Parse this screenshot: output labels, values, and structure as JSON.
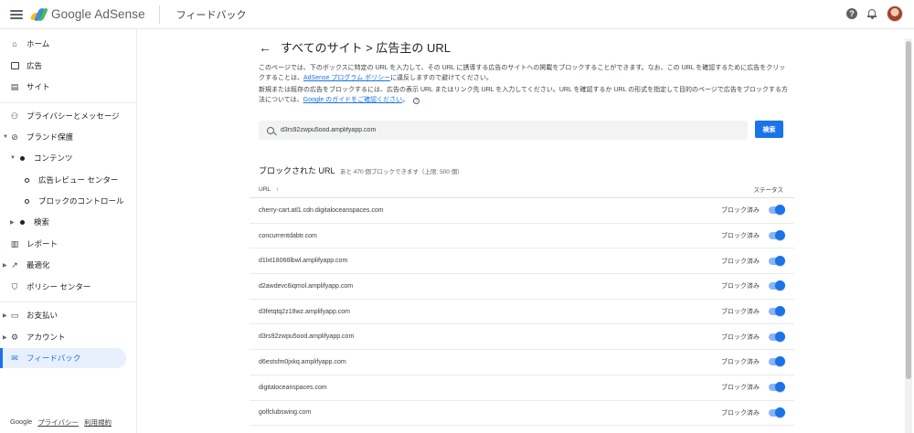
{
  "header": {
    "logo_text": "Google AdSense",
    "page_title": "フィードバック",
    "help_glyph": "?"
  },
  "sidebar": {
    "items": [
      {
        "label": "ホーム",
        "icon": "home-icon"
      },
      {
        "label": "広告",
        "icon": "ads-icon"
      },
      {
        "label": "サイト",
        "icon": "sites-icon"
      },
      {
        "label": "プライバシーとメッセージ",
        "icon": "privacy-icon"
      },
      {
        "label": "ブランド保護",
        "icon": "block-icon"
      },
      {
        "label": "コンテンツ",
        "icon": "dot-icon"
      },
      {
        "label": "広告レビュー センター",
        "icon": "ring-icon"
      },
      {
        "label": "ブロックのコントロール",
        "icon": "ring-icon"
      },
      {
        "label": "検索",
        "icon": "dot-icon"
      },
      {
        "label": "レポート",
        "icon": "reports-icon"
      },
      {
        "label": "最適化",
        "icon": "trending-icon"
      },
      {
        "label": "ポリシー センター",
        "icon": "policy-icon"
      },
      {
        "label": "お支払い",
        "icon": "payments-icon"
      },
      {
        "label": "アカウント",
        "icon": "gear-icon"
      },
      {
        "label": "フィードバック",
        "icon": "feedback-icon"
      }
    ],
    "footer": {
      "google": "Google",
      "privacy": "プライバシー",
      "terms": "利用規約"
    }
  },
  "main": {
    "title": "すべてのサイト > 広告主の URL",
    "desc1_part1": "このページでは、下のボックスに特定の URL を入力して、その URL に誘導する広告のサイトへの掲載をブロックすることができます。なお、この URL を確認するために広告をクリックすることは、",
    "desc1_link": "AdSense プログラム ポリシー",
    "desc1_part2": "に違反しますので避けてください。",
    "desc2_part1": "新規または既存の広告をブロックするには、広告の表示 URL またはリンク先 URL を入力してください。URL を確認するか URL の形式を指定して目的のページで広告をブロックする方法については、",
    "desc2_link": "Google のガイドをご確認ください",
    "desc2_part2": "。",
    "search_value": "d3rs92zwpu5ood.amplifyapp.com",
    "search_button": "検索",
    "blocked_title": "ブロックされた URL",
    "blocked_subtitle": "あと 470 個ブロックできます（上限: 500 個）",
    "col_url": "URL",
    "col_status": "ステータス",
    "rows": [
      {
        "url": "cherry-cart.atl1.cdn.digitaloceanspaces.com",
        "status": "ブロック済み"
      },
      {
        "url": "concurrentdabtr.com",
        "status": "ブロック済み"
      },
      {
        "url": "d1lxt18066lbwl.amplifyapp.com",
        "status": "ブロック済み"
      },
      {
        "url": "d2awdevc6iqmol.amplifyapp.com",
        "status": "ブロック済み"
      },
      {
        "url": "d3fetqtq2z18wz.amplifyapp.com",
        "status": "ブロック済み"
      },
      {
        "url": "d3rs92zwpu5ood.amplifyapp.com",
        "status": "ブロック済み"
      },
      {
        "url": "d6estsfm0jxkq.amplifyapp.com",
        "status": "ブロック済み"
      },
      {
        "url": "digitaloceanspaces.com",
        "status": "ブロック済み"
      },
      {
        "url": "golfclubswing.com",
        "status": "ブロック済み"
      }
    ]
  },
  "colors": {
    "accent": "#1a73e8",
    "active_bg": "#e8f0fe"
  }
}
